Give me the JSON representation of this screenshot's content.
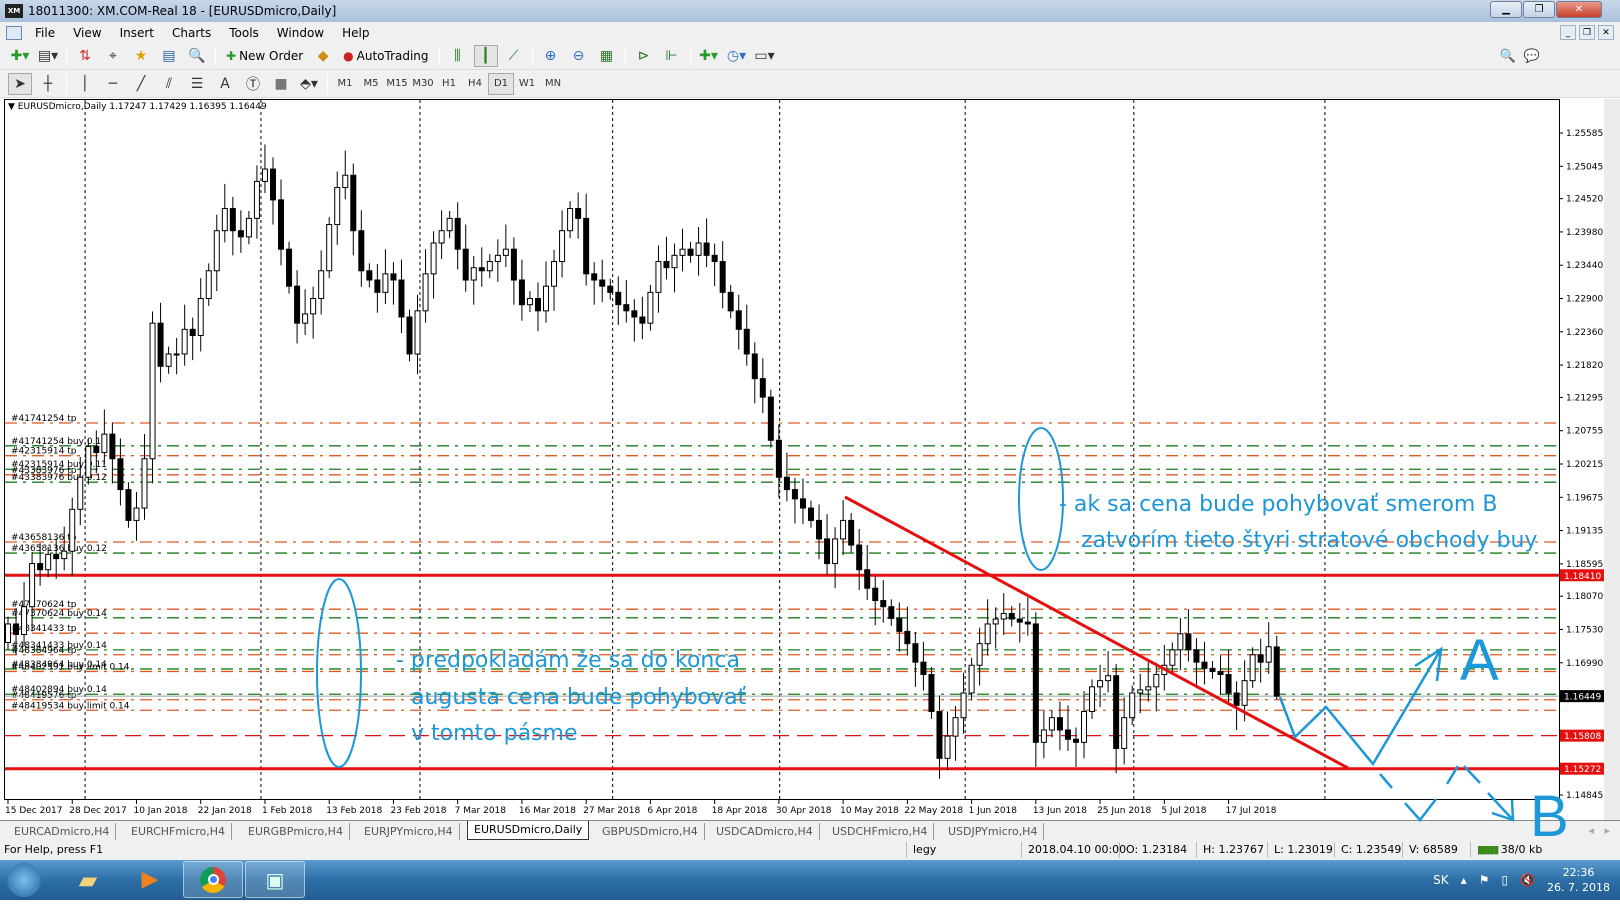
{
  "window": {
    "title": "18011300: XM.COM-Real 18 - [EURUSDmicro,Daily]",
    "logo": "XM"
  },
  "menu": [
    "File",
    "View",
    "Insert",
    "Charts",
    "Tools",
    "Window",
    "Help"
  ],
  "toolbar": {
    "new_order": "New Order",
    "auto_trading": "AutoTrading",
    "timeframes": [
      "M1",
      "M5",
      "M15",
      "M30",
      "H1",
      "H4",
      "D1",
      "W1",
      "MN"
    ],
    "active_timeframe": "D1",
    "text_tool": "A"
  },
  "chart": {
    "symbol_info": "EURUSDmicro,Daily  1.17247 1.17429 1.16395 1.16449",
    "colors": {
      "tp": "#e05a20",
      "buy": "#1b7d1b",
      "level": "#e41010",
      "annotation": "#1c98d8"
    }
  },
  "chart_data": {
    "type": "candlestick",
    "symbol": "EURUSDmicro",
    "timeframe": "Daily",
    "ohlc_last": {
      "open": 1.17247,
      "high": 1.17429,
      "low": 1.16395,
      "close": 1.16449
    },
    "closes": [
      1.1762,
      1.1745,
      1.179,
      1.186,
      1.185,
      1.1875,
      1.1868,
      1.188,
      1.1948,
      1.2,
      1.205,
      1.204,
      1.207,
      1.203,
      1.198,
      1.193,
      1.195,
      1.203,
      1.225,
      1.218,
      1.22,
      1.22,
      1.224,
      1.223,
      1.229,
      1.2335,
      1.24,
      1.2436,
      1.24,
      1.239,
      1.242,
      1.248,
      1.25,
      1.245,
      1.237,
      1.231,
      1.225,
      1.2265,
      1.229,
      1.2335,
      1.241,
      1.247,
      1.249,
      1.24,
      1.2335,
      1.232,
      1.23,
      1.233,
      1.232,
      1.226,
      1.22,
      1.227,
      1.233,
      1.238,
      1.24,
      1.242,
      1.237,
      1.232,
      1.234,
      1.2335,
      1.235,
      1.236,
      1.237,
      1.232,
      1.228,
      1.229,
      1.227,
      1.231,
      1.235,
      1.24,
      1.2436,
      1.242,
      1.233,
      1.232,
      1.231,
      1.23,
      1.228,
      1.227,
      1.226,
      1.225,
      1.23,
      1.235,
      1.234,
      1.236,
      1.237,
      1.236,
      1.238,
      1.236,
      1.235,
      1.23,
      1.227,
      1.224,
      1.22,
      1.216,
      1.213,
      1.206,
      1.2,
      1.198,
      1.1965,
      1.195,
      1.193,
      1.19,
      1.186,
      1.19,
      1.193,
      1.189,
      1.185,
      1.182,
      1.18,
      1.179,
      1.1771,
      1.175,
      1.173,
      1.17,
      1.168,
      1.162,
      1.1544,
      1.158,
      1.161,
      1.165,
      1.1695,
      1.173,
      1.1762,
      1.177,
      1.1779,
      1.177,
      1.1765,
      1.1762,
      1.157,
      1.159,
      1.161,
      1.159,
      1.1575,
      1.157,
      1.162,
      1.166,
      1.167,
      1.1678,
      1.156,
      1.161,
      1.165,
      1.1655,
      1.166,
      1.168,
      1.1695,
      1.172,
      1.1746,
      1.172,
      1.17,
      1.169,
      1.1685,
      1.168,
      1.165,
      1.163,
      1.167,
      1.1712,
      1.17,
      1.1725,
      1.16449
    ],
    "x_tick_labels": [
      "15 Dec 2017",
      "28 Dec 2017",
      "10 Jan 2018",
      "22 Jan 2018",
      "1 Feb 2018",
      "13 Feb 2018",
      "23 Feb 2018",
      "7 Mar 2018",
      "16 Mar 2018",
      "27 Mar 2018",
      "6 Apr 2018",
      "18 Apr 2018",
      "30 Apr 2018",
      "10 May 2018",
      "22 May 2018",
      "1 Jun 2018",
      "13 Jun 2018",
      "25 Jun 2018",
      "5 Jul 2018",
      "17 Jul 2018"
    ],
    "y_tick_labels": [
      "1.25585",
      "1.25045",
      "1.24520",
      "1.23980",
      "1.23440",
      "1.22900",
      "1.22360",
      "1.21820",
      "1.21295",
      "1.20755",
      "1.20215",
      "1.19675",
      "1.19135",
      "1.18595",
      "1.18070",
      "1.17530",
      "1.16990",
      "1.15810",
      "1.15285",
      "1.14845"
    ],
    "ylim": [
      1.14845,
      1.25585
    ],
    "current_price": "1.16449",
    "levels": [
      {
        "price": "1.18410",
        "style": "solid"
      },
      {
        "price": "1.15808",
        "style": "dashed"
      },
      {
        "price": "1.15272",
        "style": "solid"
      }
    ],
    "orders": [
      {
        "label": "#41741254 tp",
        "price": 1.2088,
        "kind": "tp"
      },
      {
        "label": "#41741254 buy 0.11",
        "price": 1.2051,
        "kind": "buy"
      },
      {
        "label": "#42315914 tp",
        "price": 1.2035,
        "kind": "tp"
      },
      {
        "label": "#42315914 buy 0.11",
        "price": 1.2013,
        "kind": "buy"
      },
      {
        "label": "#43383976 tp",
        "price": 1.2004,
        "kind": "tp"
      },
      {
        "label": "#43383976 buy 0.12",
        "price": 1.1992,
        "kind": "buy"
      },
      {
        "label": "#43658136 tp",
        "price": 1.1895,
        "kind": "tp"
      },
      {
        "label": "#43658136 buy 0.12",
        "price": 1.1877,
        "kind": "buy"
      },
      {
        "label": "#47370624 tp",
        "price": 1.1786,
        "kind": "tp"
      },
      {
        "label": "#47370624 buy 0.14",
        "price": 1.1772,
        "kind": "buy"
      },
      {
        "label": "#48341433 tp",
        "price": 1.1747,
        "kind": "tp"
      },
      {
        "label": "#48341433 buy 0.14",
        "price": 1.172,
        "kind": "buy"
      },
      {
        "label": "#48384964 tp",
        "price": 1.1712,
        "kind": "tp"
      },
      {
        "label": "#48384964 buy 0.14",
        "price": 1.1689,
        "kind": "buy"
      },
      {
        "label": "#48402591 buy limit 0.14",
        "price": 1.1685,
        "kind": "tp"
      },
      {
        "label": "#48402894 buy 0.14",
        "price": 1.1648,
        "kind": "buy"
      },
      {
        "label": "#48419576 tp",
        "price": 1.1639,
        "kind": "tp"
      },
      {
        "label": "#48419534 buy limit 0.14",
        "price": 1.1622,
        "kind": "tp"
      }
    ],
    "month_separators": [
      "Jan 2018",
      "Feb 2018",
      "Mar 2018",
      "Apr 2018",
      "May 2018",
      "Jun 2018",
      "Jul 2018",
      "Aug 2018"
    ]
  },
  "annotations": {
    "left": [
      "- predpokladám že sa do konca",
      "augusta cena bude pohybovať",
      "v tomto pásme"
    ],
    "right": [
      "- ak sa cena bude pohybovať smerom B",
      "zatvorím tieto štyri stratové obchody buy"
    ],
    "letter_a": "A",
    "letter_b": "B"
  },
  "tabs": [
    "EURCADmicro,H4",
    "EURCHFmicro,H4",
    "EURGBPmicro,H4",
    "EURJPYmicro,H4",
    "EURUSDmicro,Daily",
    "GBPUSDmicro,H4",
    "USDCADmicro,H4",
    "USDCHFmicro,H4",
    "USDJPYmicro,H4"
  ],
  "active_tab": "EURUSDmicro,Daily",
  "status": {
    "help": "For Help, press F1",
    "profile": "legy",
    "datetime": "2018.04.10 00:00",
    "open": "O: 1.23184",
    "high": "H: 1.23767",
    "low": "L: 1.23019",
    "close": "C: 1.23549",
    "volume": "V: 68589",
    "traffic": "38/0 kb"
  },
  "taskbar": {
    "language": "SK",
    "time": "22:36",
    "date": "26. 7. 2018"
  }
}
